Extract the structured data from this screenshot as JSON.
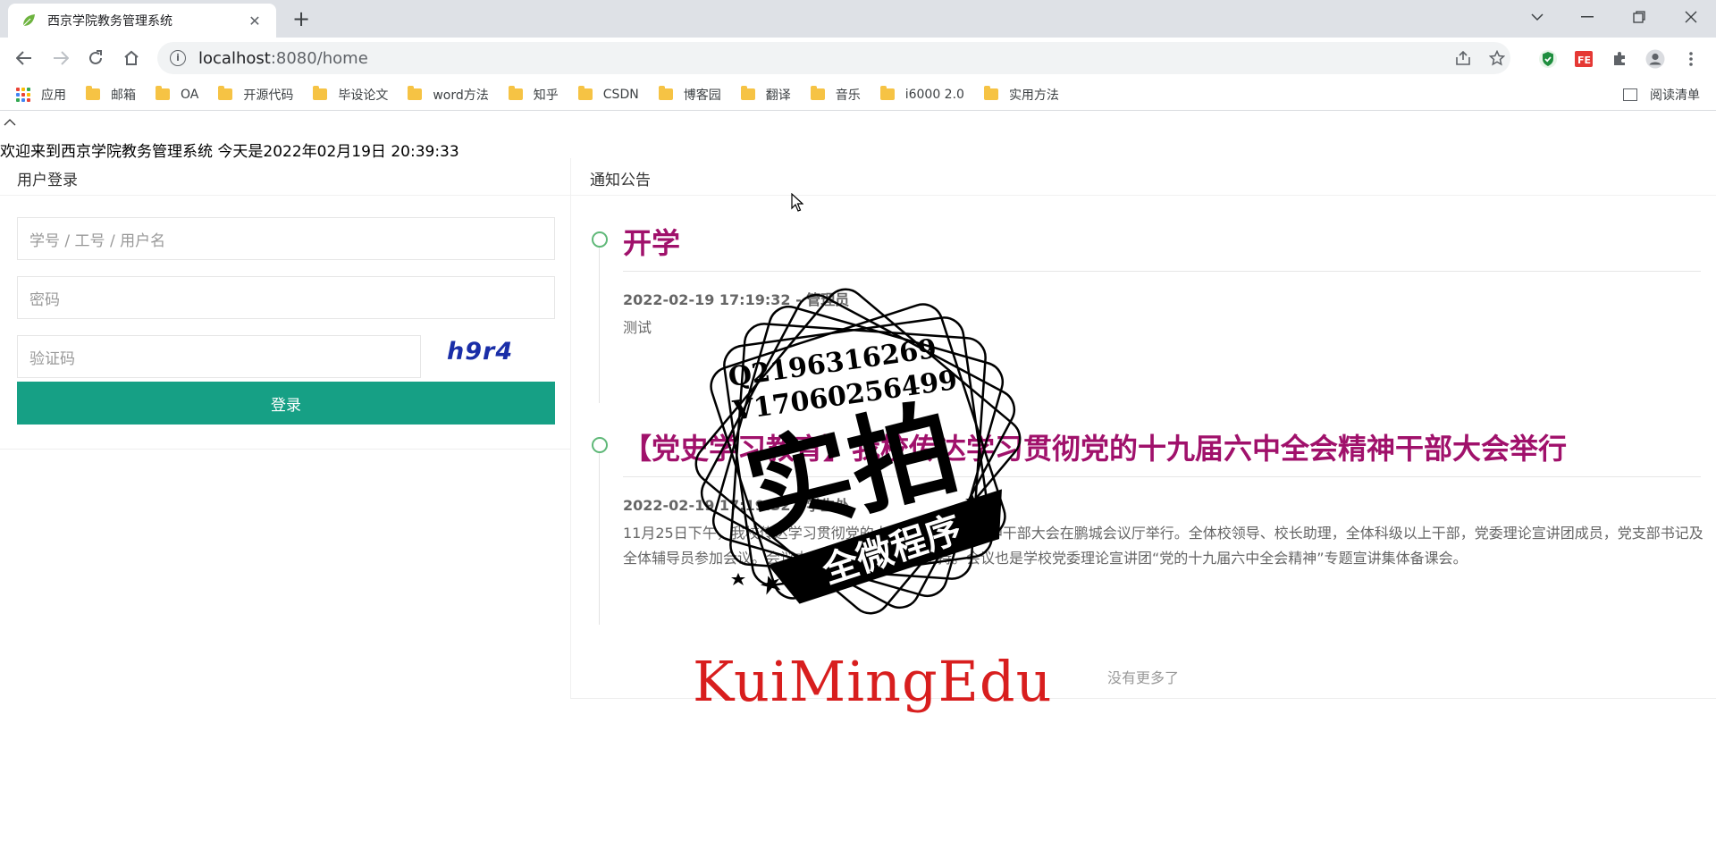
{
  "browser": {
    "tab_title": "西京学院教务管理系统",
    "tab_close": "✕",
    "new_tab": "+",
    "url_host": "localhost",
    "url_path": ":8080/home",
    "window_controls": [
      "chevron-down-icon",
      "minimize-icon",
      "restore-icon",
      "close-icon"
    ],
    "bookmarks_apps": "应用",
    "bookmarks": [
      "邮箱",
      "OA",
      "开源代码",
      "毕设论文",
      "word方法",
      "知乎",
      "CSDN",
      "博客园",
      "翻译",
      "音乐",
      "i6000 2.0",
      "实用方法"
    ],
    "reading_list": "阅读清单"
  },
  "page": {
    "welcome": "欢迎来到西京学院教务管理系统 今天是2022年02月19日 20:39:33",
    "login": {
      "header": "用户登录",
      "username_placeholder": "学号 / 工号 / 用户名",
      "password_placeholder": "密码",
      "captcha_placeholder": "验证码",
      "captcha_text": "h9r4",
      "submit_label": "登录"
    },
    "notices": {
      "header": "通知公告",
      "items": [
        {
          "title": "开学",
          "meta": "2022-02-19 17:19:32 - 管理员",
          "body": "测试"
        },
        {
          "title": "【党史学习教育】我校传达学习贯彻党的十九届六中全会精神干部大会举行",
          "meta": "2022-02-19 17:19:32 - 学生处",
          "body": "11月25日下午，我校传达学习贯彻党的十九届六中全会精神干部大会在鹏城会议厅举行。全体校领导、校长助理，全体科级以上干部，党委理论宣讲团成员，党支部书记及全体辅导员参加会议。会议由党委副书记车小真主持。会议也是学校党委理论宣讲团“党的十九届六中全会精神”专题宣讲集体备课会。"
        }
      ],
      "no_more": "没有更多了"
    }
  },
  "watermark": {
    "line1": "Q2196316269",
    "line2": "V17060256499",
    "big": "实拍",
    "banner": "全微程序",
    "brand": "KuiMingEdu"
  },
  "colors": {
    "accent_green": "#16a085",
    "title_magenta": "#a0116b",
    "watermark_red": "#d81e1e"
  }
}
